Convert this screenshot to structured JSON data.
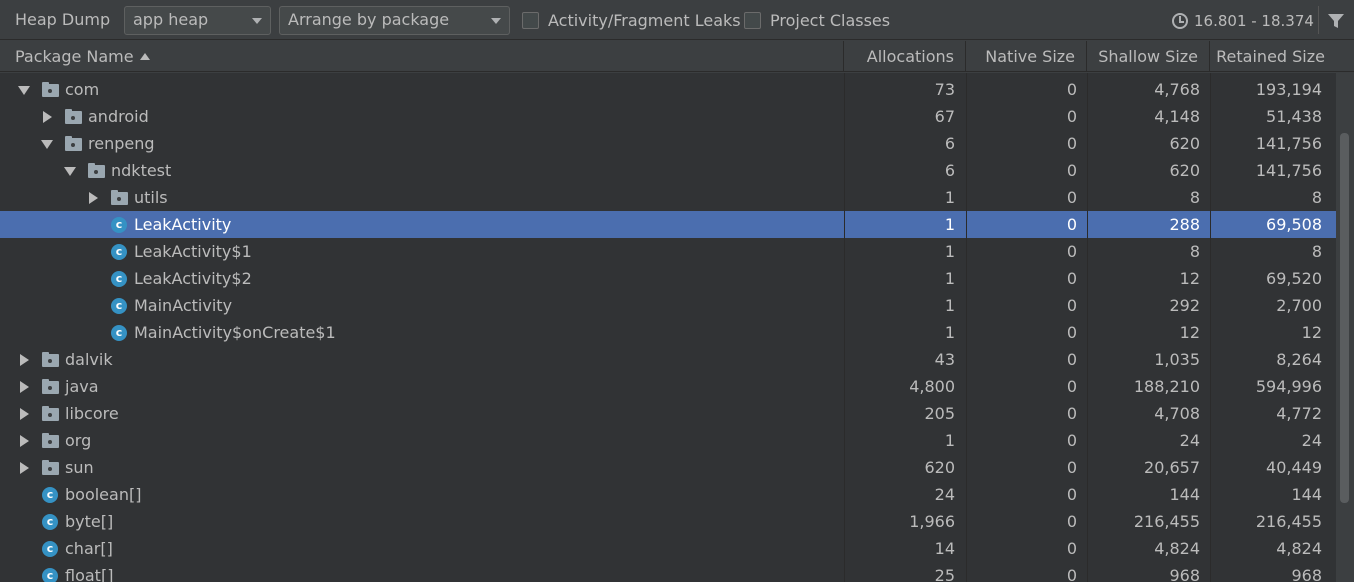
{
  "toolbar": {
    "title": "Heap Dump",
    "heap_select": "app heap",
    "arrange_select": "Arrange by package",
    "chk_leaks": "Activity/Fragment Leaks",
    "chk_project": "Project Classes",
    "time_range": "16.801 - 18.374"
  },
  "columns": {
    "name": "Package Name",
    "allocations": "Allocations",
    "native": "Native Size",
    "shallow": "Shallow Size",
    "retained": "Retained Size"
  },
  "rows": [
    {
      "name": "com",
      "alloc": "73",
      "native": "0",
      "shallow": "4,768",
      "retained": "193,194"
    },
    {
      "name": "android",
      "alloc": "67",
      "native": "0",
      "shallow": "4,148",
      "retained": "51,438"
    },
    {
      "name": "renpeng",
      "alloc": "6",
      "native": "0",
      "shallow": "620",
      "retained": "141,756"
    },
    {
      "name": "ndktest",
      "alloc": "6",
      "native": "0",
      "shallow": "620",
      "retained": "141,756"
    },
    {
      "name": "utils",
      "alloc": "1",
      "native": "0",
      "shallow": "8",
      "retained": "8"
    },
    {
      "name": "LeakActivity",
      "alloc": "1",
      "native": "0",
      "shallow": "288",
      "retained": "69,508"
    },
    {
      "name": "LeakActivity$1",
      "alloc": "1",
      "native": "0",
      "shallow": "8",
      "retained": "8"
    },
    {
      "name": "LeakActivity$2",
      "alloc": "1",
      "native": "0",
      "shallow": "12",
      "retained": "69,520"
    },
    {
      "name": "MainActivity",
      "alloc": "1",
      "native": "0",
      "shallow": "292",
      "retained": "2,700"
    },
    {
      "name": "MainActivity$onCreate$1",
      "alloc": "1",
      "native": "0",
      "shallow": "12",
      "retained": "12"
    },
    {
      "name": "dalvik",
      "alloc": "43",
      "native": "0",
      "shallow": "1,035",
      "retained": "8,264"
    },
    {
      "name": "java",
      "alloc": "4,800",
      "native": "0",
      "shallow": "188,210",
      "retained": "594,996"
    },
    {
      "name": "libcore",
      "alloc": "205",
      "native": "0",
      "shallow": "4,708",
      "retained": "4,772"
    },
    {
      "name": "org",
      "alloc": "1",
      "native": "0",
      "shallow": "24",
      "retained": "24"
    },
    {
      "name": "sun",
      "alloc": "620",
      "native": "0",
      "shallow": "20,657",
      "retained": "40,449"
    },
    {
      "name": "boolean[]",
      "alloc": "24",
      "native": "0",
      "shallow": "144",
      "retained": "144"
    },
    {
      "name": "byte[]",
      "alloc": "1,966",
      "native": "0",
      "shallow": "216,455",
      "retained": "216,455"
    },
    {
      "name": "char[]",
      "alloc": "14",
      "native": "0",
      "shallow": "4,824",
      "retained": "4,824"
    },
    {
      "name": "float[]",
      "alloc": "25",
      "native": "0",
      "shallow": "968",
      "retained": "968"
    }
  ]
}
